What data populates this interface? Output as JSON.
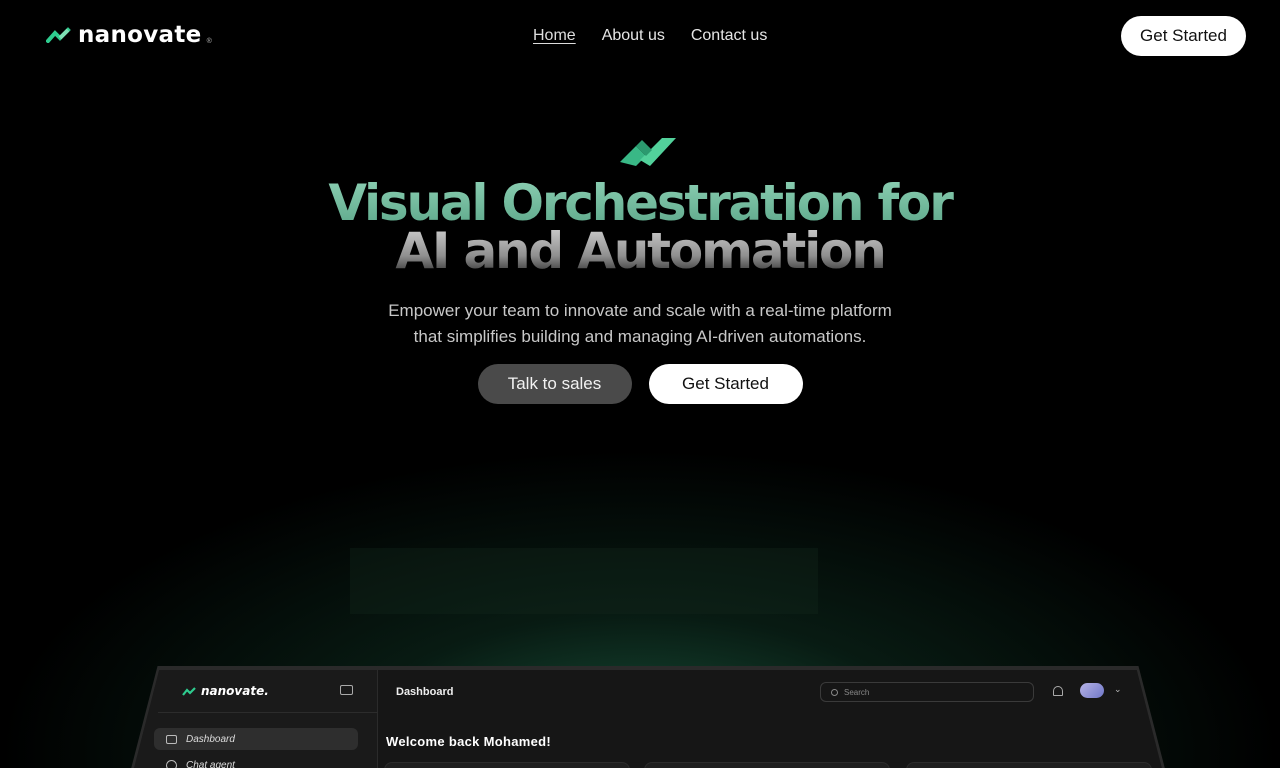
{
  "brand": {
    "name": "nanovate",
    "registered": "®",
    "accent": "#2ecc8f"
  },
  "nav": {
    "links": [
      {
        "label": "Home",
        "active": true
      },
      {
        "label": "About us",
        "active": false
      },
      {
        "label": "Contact us",
        "active": false
      }
    ],
    "cta": "Get Started"
  },
  "hero": {
    "title_line1": "Visual Orchestration for",
    "title_line2": "AI and Automation",
    "subtitle_line1": "Empower your team to innovate and scale with a real-time platform",
    "subtitle_line2": "that simplifies building and managing AI-driven automations.",
    "secondary_button": "Talk to sales",
    "primary_button": "Get Started"
  },
  "dashboard": {
    "brand": "nanovate.",
    "page_title": "Dashboard",
    "search_placeholder": "Search",
    "welcome": "Welcome back Mohamed!",
    "sidebar_items": [
      {
        "label": "Dashboard",
        "icon": "grid-icon",
        "active": true
      },
      {
        "label": "Chat agent",
        "icon": "chat-icon",
        "active": false
      }
    ]
  }
}
